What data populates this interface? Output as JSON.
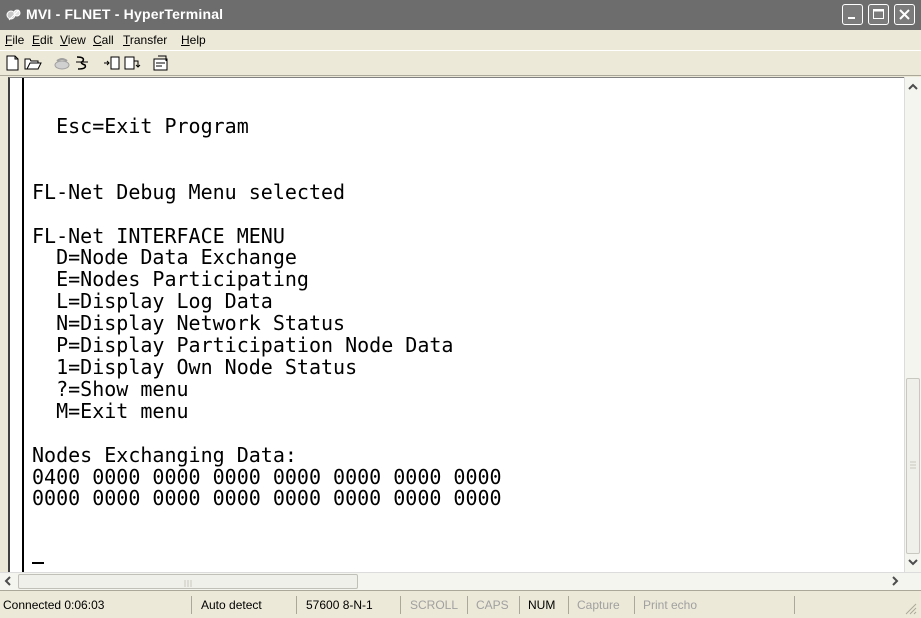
{
  "window": {
    "title": "MVI - FLNET - HyperTerminal"
  },
  "menu": [
    "File",
    "Edit",
    "View",
    "Call",
    "Transfer",
    "Help"
  ],
  "toolbar_icons": [
    "new-connection-icon",
    "open-icon",
    "disconnect-icon",
    "dial-icon",
    "send-icon",
    "receive-icon",
    "properties-icon"
  ],
  "terminal": {
    "lines": [
      "  Esc=Exit Program",
      "",
      "",
      "FL-Net Debug Menu selected",
      "",
      "FL-Net INTERFACE MENU",
      "  D=Node Data Exchange",
      "  E=Nodes Participating",
      "  L=Display Log Data",
      "  N=Display Network Status",
      "  P=Display Participation Node Data",
      "  1=Display Own Node Status",
      "  ?=Show menu",
      "  M=Exit menu",
      "",
      "Nodes Exchanging Data:",
      "0400 0000 0000 0000 0000 0000 0000 0000",
      "0000 0000 0000 0000 0000 0000 0000 0000"
    ]
  },
  "status": {
    "connected": "Connected 0:06:03",
    "detect": "Auto detect",
    "settings": "57600 8-N-1",
    "scroll": "SCROLL",
    "caps": "CAPS",
    "num": "NUM",
    "capture": "Capture",
    "print": "Print echo"
  },
  "colors": {
    "titlebar": "#6d6d6d",
    "chrome": "#ece9d8",
    "terminal_bg": "#ffffff",
    "disabled_text": "#a0a0a0"
  }
}
